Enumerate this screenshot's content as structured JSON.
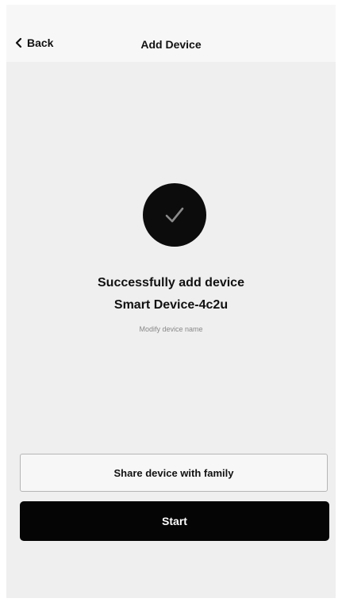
{
  "nav": {
    "back_label": "Back",
    "title": "Add Device",
    "back_icon": "chevron-left-icon"
  },
  "status": {
    "icon": "checkmark-icon",
    "title": "Successfully add device",
    "device_name": "Smart Device-4c2u",
    "modify_link": "Modify device name"
  },
  "actions": {
    "share_label": "Share device with family",
    "start_label": "Start"
  },
  "colors": {
    "background": "#efefef",
    "nav_background": "#f7f7f7",
    "primary": "#050505",
    "primary_text": "#ffffff"
  }
}
